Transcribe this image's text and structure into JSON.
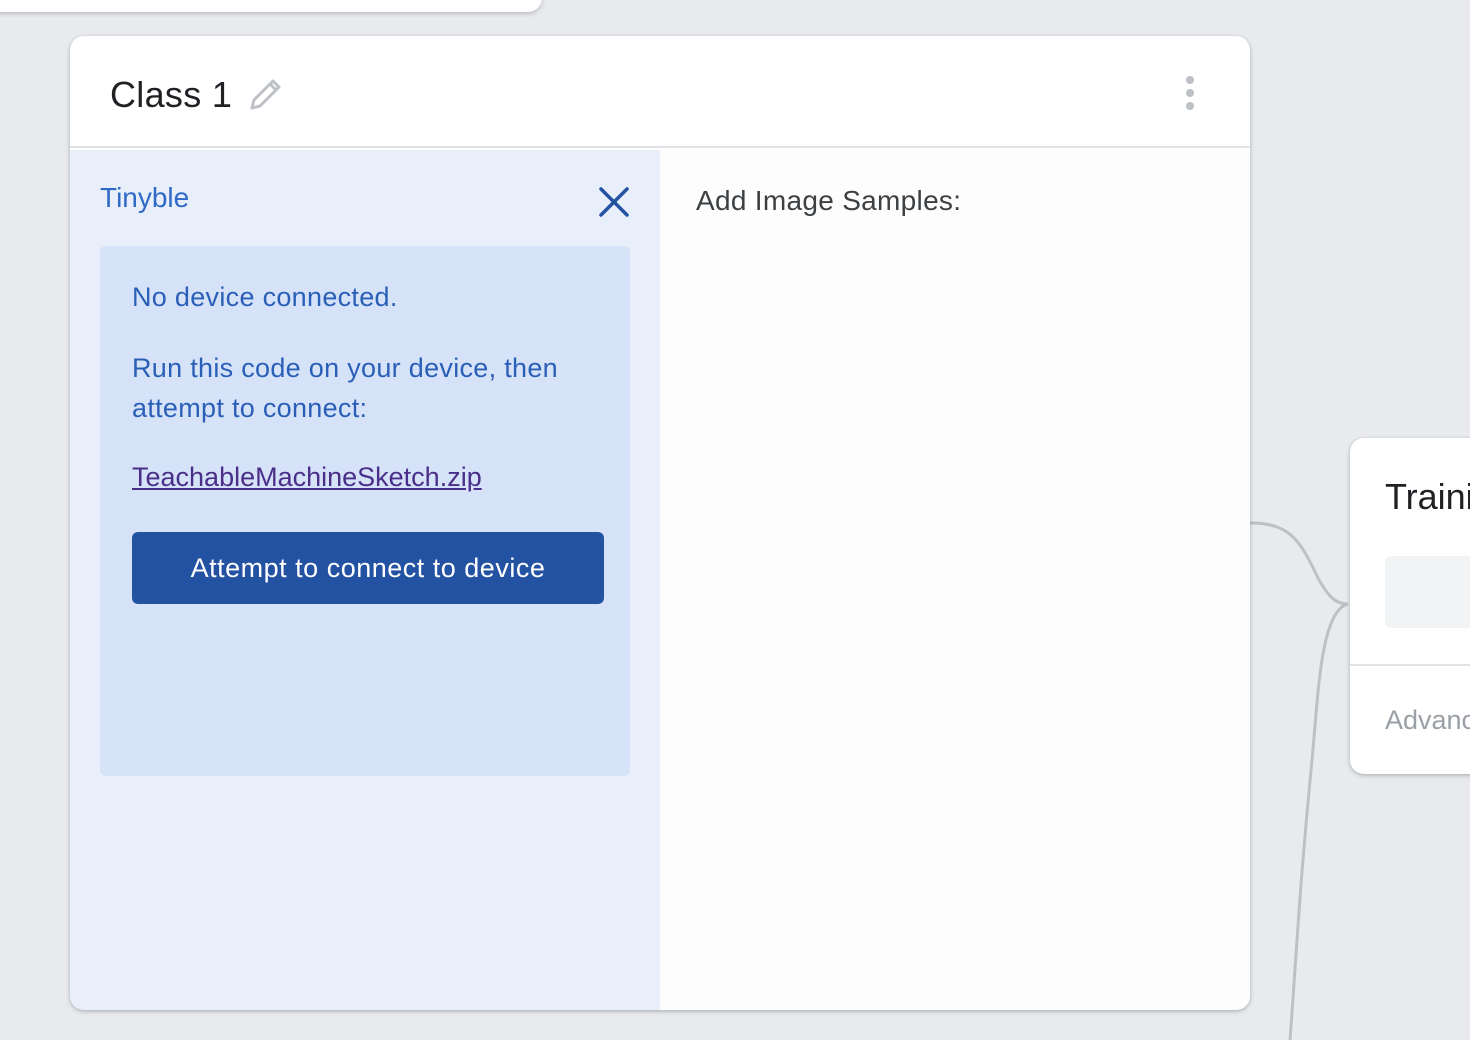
{
  "class_card": {
    "title": "Class 1",
    "device_panel": {
      "device_name": "Tinyble",
      "status": "No device connected.",
      "instruction": "Run this code on your device, then attempt to connect:",
      "sketch_link": "TeachableMachineSketch.zip",
      "connect_button": "Attempt to connect to device"
    },
    "samples_panel": {
      "title": "Add Image Samples:"
    }
  },
  "training_card": {
    "title": "Training",
    "advanced_label": "Advanced"
  },
  "icons": {
    "edit": "pencil-icon",
    "more": "more-vert-icon",
    "close": "close-icon"
  },
  "colors": {
    "background": "#e8eaed",
    "device_panel_bg": "#e8effb",
    "device_box_bg": "#d6e2f8",
    "accent_text": "#2a5fb8",
    "button_bg": "#2452a2",
    "link": "#4a2f8a"
  }
}
